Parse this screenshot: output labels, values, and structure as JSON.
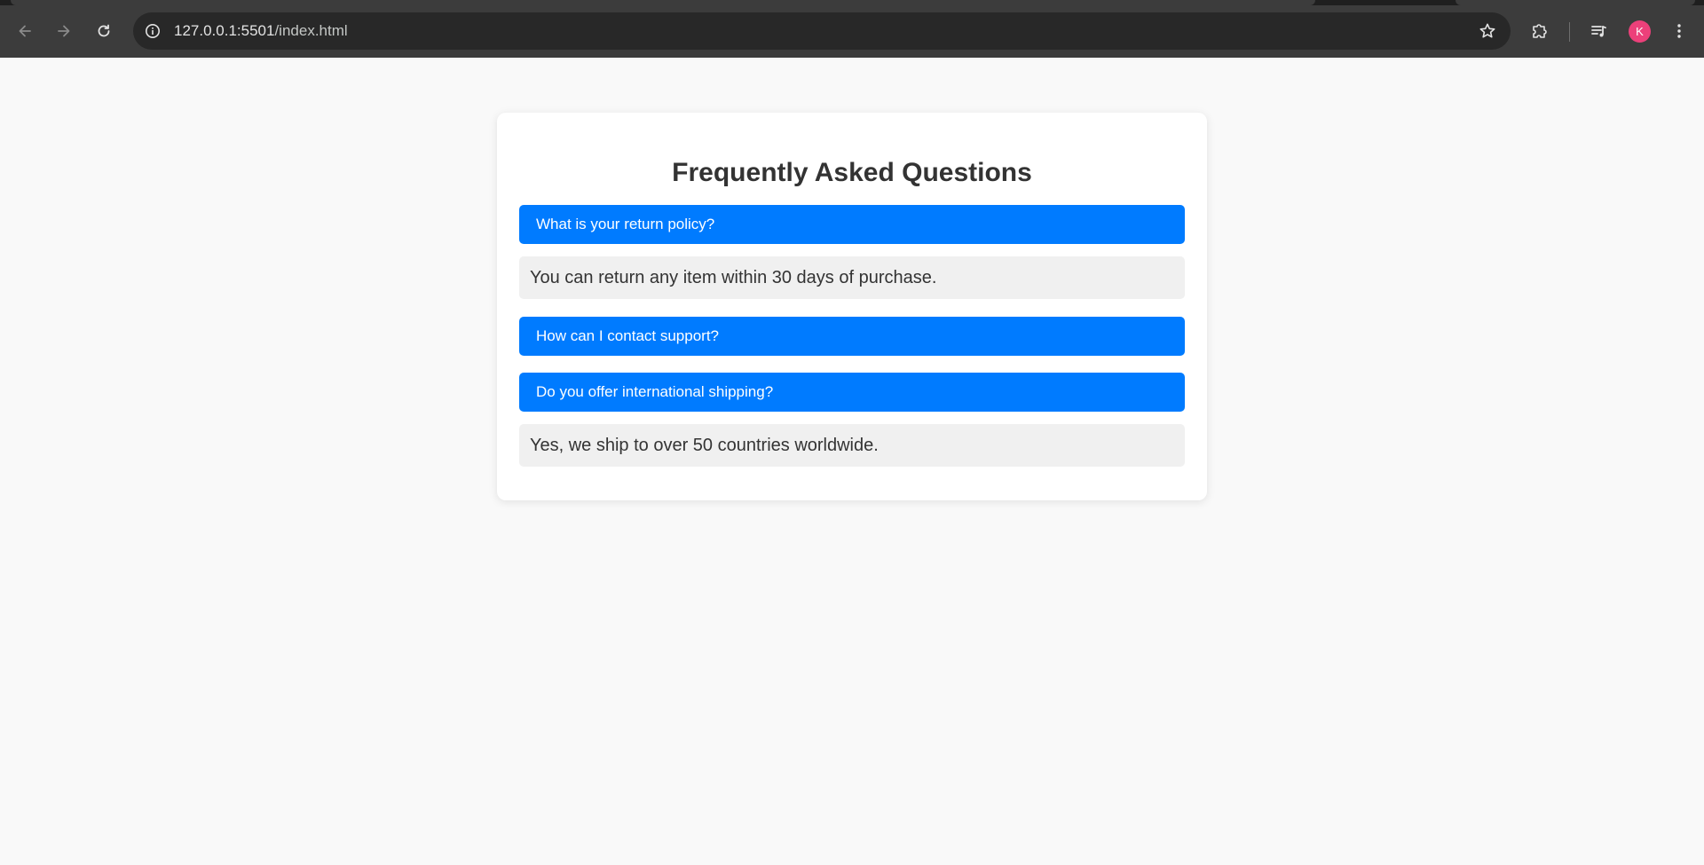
{
  "browser": {
    "url_host": "127.0.0.1:5501",
    "url_path": "/index.html",
    "avatar_initial": "K",
    "icons": {
      "back": "back-arrow-icon",
      "forward": "forward-arrow-icon",
      "reload": "reload-icon",
      "site_info": "info-icon",
      "bookmark": "star-icon",
      "extensions": "puzzle-icon",
      "media": "media-queue-icon",
      "menu": "kebab-menu-icon"
    },
    "colors": {
      "toolbar": "#3c3c3c",
      "omnibox": "#282828",
      "avatar": "#ec407a"
    }
  },
  "faq": {
    "title": "Frequently Asked Questions",
    "items": [
      {
        "question": "What is your return policy?",
        "answer": "You can return any item within 30 days of purchase.",
        "expanded": true
      },
      {
        "question": "How can I contact support?",
        "answer": "",
        "expanded": false
      },
      {
        "question": "Do you offer international shipping?",
        "answer": "Yes, we ship to over 50 countries worldwide.",
        "expanded": true
      }
    ],
    "colors": {
      "question_bg": "#007bff",
      "answer_bg": "#f0f0f0",
      "text": "#333333",
      "page_bg": "#f9f9f9"
    }
  }
}
